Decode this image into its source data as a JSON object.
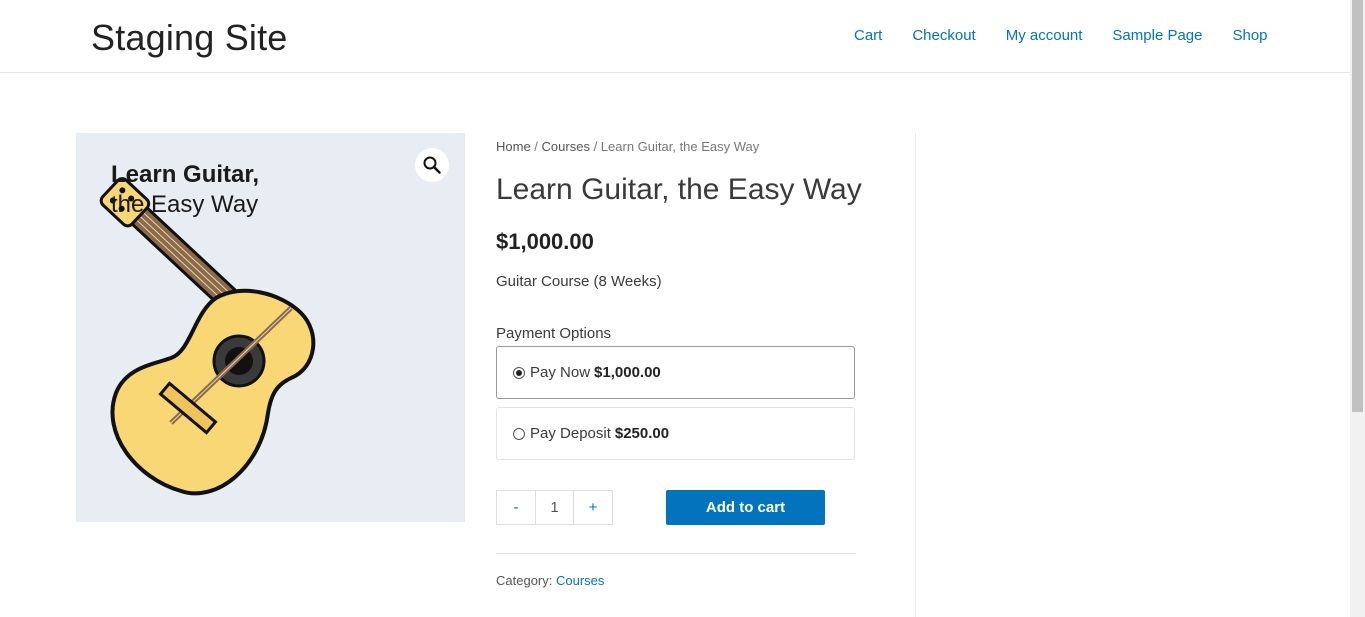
{
  "site": {
    "title": "Staging Site"
  },
  "nav": {
    "items": [
      "Cart",
      "Checkout",
      "My account",
      "Sample Page",
      "Shop"
    ]
  },
  "image": {
    "line1": "Learn Guitar,",
    "line2": "the Easy Way"
  },
  "breadcrumb": {
    "home": "Home",
    "sep1": " / ",
    "courses": "Courses",
    "sep2": " / ",
    "current": "Learn Guitar, the Easy Way"
  },
  "product": {
    "title": "Learn Guitar, the Easy Way",
    "price": "$1,000.00",
    "short_description": "Guitar Course (8 Weeks)"
  },
  "payment": {
    "label": "Payment Options",
    "options": [
      {
        "label": "Pay Now",
        "amount": "$1,000.00",
        "selected": true
      },
      {
        "label": "Pay Deposit",
        "amount": "$250.00",
        "selected": false
      }
    ]
  },
  "cart": {
    "minus": "-",
    "quantity": "1",
    "plus": "+",
    "add_label": "Add to cart"
  },
  "meta": {
    "category_label": "Category: ",
    "category_value": "Courses"
  },
  "colors": {
    "accent": "#0274be",
    "image_bg": "#e8edf3",
    "guitar_body": "#f9d774"
  },
  "icons": {
    "zoom": "magnifier-icon"
  }
}
